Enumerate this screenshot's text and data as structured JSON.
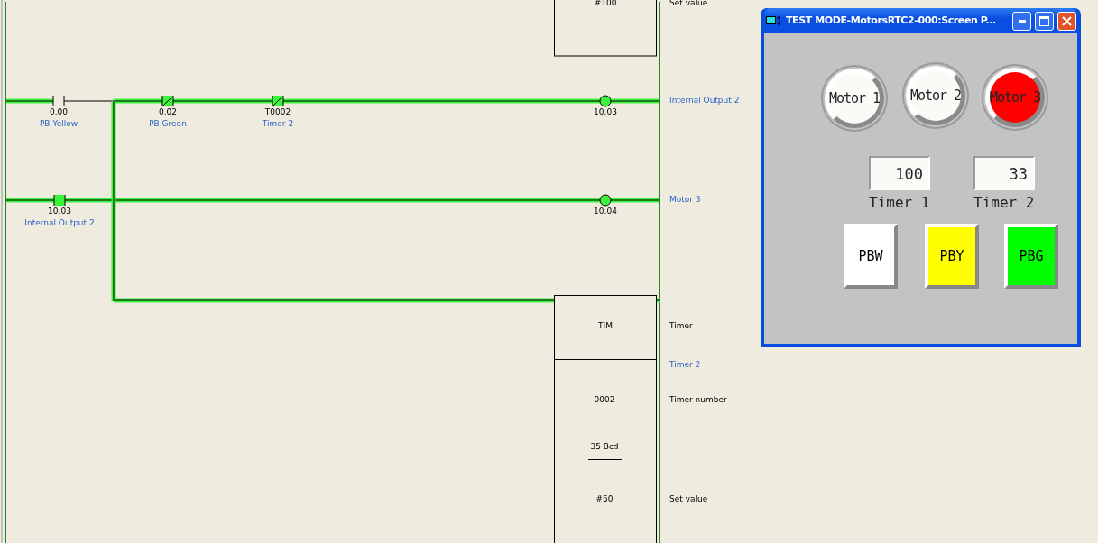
{
  "ladder": {
    "top_block": {
      "value": "#100",
      "label": "Set value"
    },
    "elements": [
      {
        "kind": "contact_no",
        "address": "0.00",
        "comment": "PB Yellow",
        "energized": false
      },
      {
        "kind": "contact_nc",
        "address": "0.02",
        "comment": "PB Green",
        "energized": true
      },
      {
        "kind": "contact_nc",
        "address": "T0002",
        "comment": "Timer 2",
        "energized": true
      },
      {
        "kind": "coil",
        "address": "10.03",
        "comment": "Internal Output 2",
        "energized": true
      },
      {
        "kind": "contact_no",
        "address": "10.03",
        "comment": "Internal Output 2",
        "energized": true
      },
      {
        "kind": "coil",
        "address": "10.04",
        "comment": "Motor 3",
        "energized": true
      }
    ],
    "timer_block": {
      "instruction": "TIM",
      "instruction_label": "Timer",
      "comment": "Timer 2",
      "number": "0002",
      "number_label": "Timer number",
      "present_value": "35 Bcd",
      "set_value": "#50",
      "set_value_label": "Set value"
    }
  },
  "hmi_window": {
    "title": "TEST MODE-MotorsRTC2-000:Screen P...",
    "lamps": [
      {
        "label": "Motor 1",
        "on": false
      },
      {
        "label": "Motor 2",
        "on": false
      },
      {
        "label": "Motor 3",
        "on": true
      }
    ],
    "displays": [
      {
        "value": "100",
        "label": "Timer 1"
      },
      {
        "value": "33",
        "label": "Timer 2"
      }
    ],
    "buttons": [
      {
        "label": "PBW",
        "color": "#ffffff"
      },
      {
        "label": "PBY",
        "color": "#ffff00"
      },
      {
        "label": "PBG",
        "color": "#00ff00"
      }
    ]
  }
}
